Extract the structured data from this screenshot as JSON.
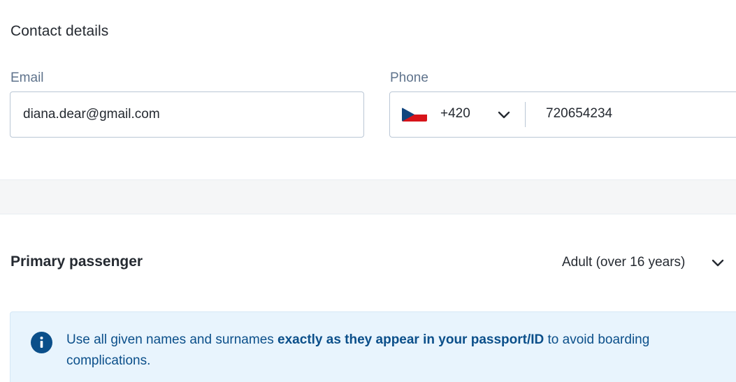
{
  "contact": {
    "title": "Contact details",
    "email_label": "Email",
    "email_value": "diana.dear@gmail.com",
    "phone_label": "Phone",
    "country_code": "+420",
    "country_flag": "czech-flag",
    "phone_value": "720654234"
  },
  "passenger": {
    "title": "Primary passenger",
    "age_category": "Adult (over 16 years)"
  },
  "info_banner": {
    "text_before": "Use all given names and surnames ",
    "text_bold": "exactly as they appear in your passport/ID",
    "text_after": " to avoid boarding complications.",
    "icon": "info-icon"
  },
  "colors": {
    "accent_blue": "#0b4f8a",
    "banner_bg": "#e8f4fd",
    "border": "#bac7d5"
  }
}
